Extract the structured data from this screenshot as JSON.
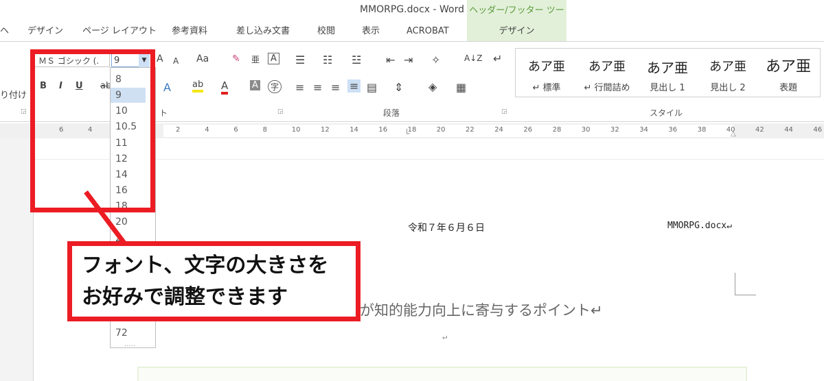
{
  "window": {
    "title": "MMORPG.docx - Word",
    "contextual_tab_header": "ヘッダー/フッター ツール"
  },
  "tabs": [
    {
      "label": "ヘ"
    },
    {
      "label": "デザイン"
    },
    {
      "label": "ページ レイアウト"
    },
    {
      "label": "参考資料"
    },
    {
      "label": "差し込み文書"
    },
    {
      "label": "校閲"
    },
    {
      "label": "表示"
    },
    {
      "label": "ACROBAT"
    },
    {
      "label": "デザイン"
    }
  ],
  "ribbon": {
    "font_name": "ＭＳ ゴシック (.",
    "font_size": "9",
    "partial_left_label": "り付け",
    "bold": "B",
    "italic": "I",
    "underline": "U",
    "strike": "ab",
    "grow_font": "A",
    "shrink_font": "A",
    "change_case": "Aa",
    "phonetic_guide": "亜",
    "char_border": "A",
    "text_effect": "A",
    "highlight": "ab",
    "font_color": "A",
    "char_shading": "A",
    "enclose_char": "字",
    "sort": "A↓Z",
    "groups": {
      "font": "ト",
      "paragraph": "段落",
      "styles": "スタイル"
    },
    "styles": [
      {
        "sample": "あア亜",
        "name": "↵ 標準"
      },
      {
        "sample": "あア亜",
        "name": "↵ 行間詰め"
      },
      {
        "sample": "あア亜",
        "name": "見出し 1"
      },
      {
        "sample": "あア亜",
        "name": "見出し 2"
      },
      {
        "sample": "あア亜",
        "name": "表題"
      }
    ]
  },
  "ruler": {
    "left_numbers": [
      "6",
      "4",
      "2"
    ],
    "numbers": [
      "2",
      "4",
      "6",
      "8",
      "10",
      "12",
      "14",
      "16",
      "18",
      "20",
      "22",
      "24",
      "26",
      "28",
      "30",
      "32",
      "34",
      "36",
      "38",
      "40",
      "42",
      "44",
      "46"
    ]
  },
  "font_size_dropdown": {
    "options": [
      "8",
      "9",
      "10",
      "10.5",
      "11",
      "12",
      "14",
      "16",
      "18",
      "20",
      "2",
      "72"
    ],
    "selected": "9",
    "more": "....."
  },
  "document": {
    "header_date": "令和７年６月６日",
    "header_filename": "MMORPG.docx↵",
    "heading_partial": "が知的能力向上に寄与するポイント↵",
    "empty_para_mark": "↵"
  },
  "annotation": {
    "callout_line1": "フォント、文字の大きさを",
    "callout_line2": "お好みで調整できます"
  }
}
